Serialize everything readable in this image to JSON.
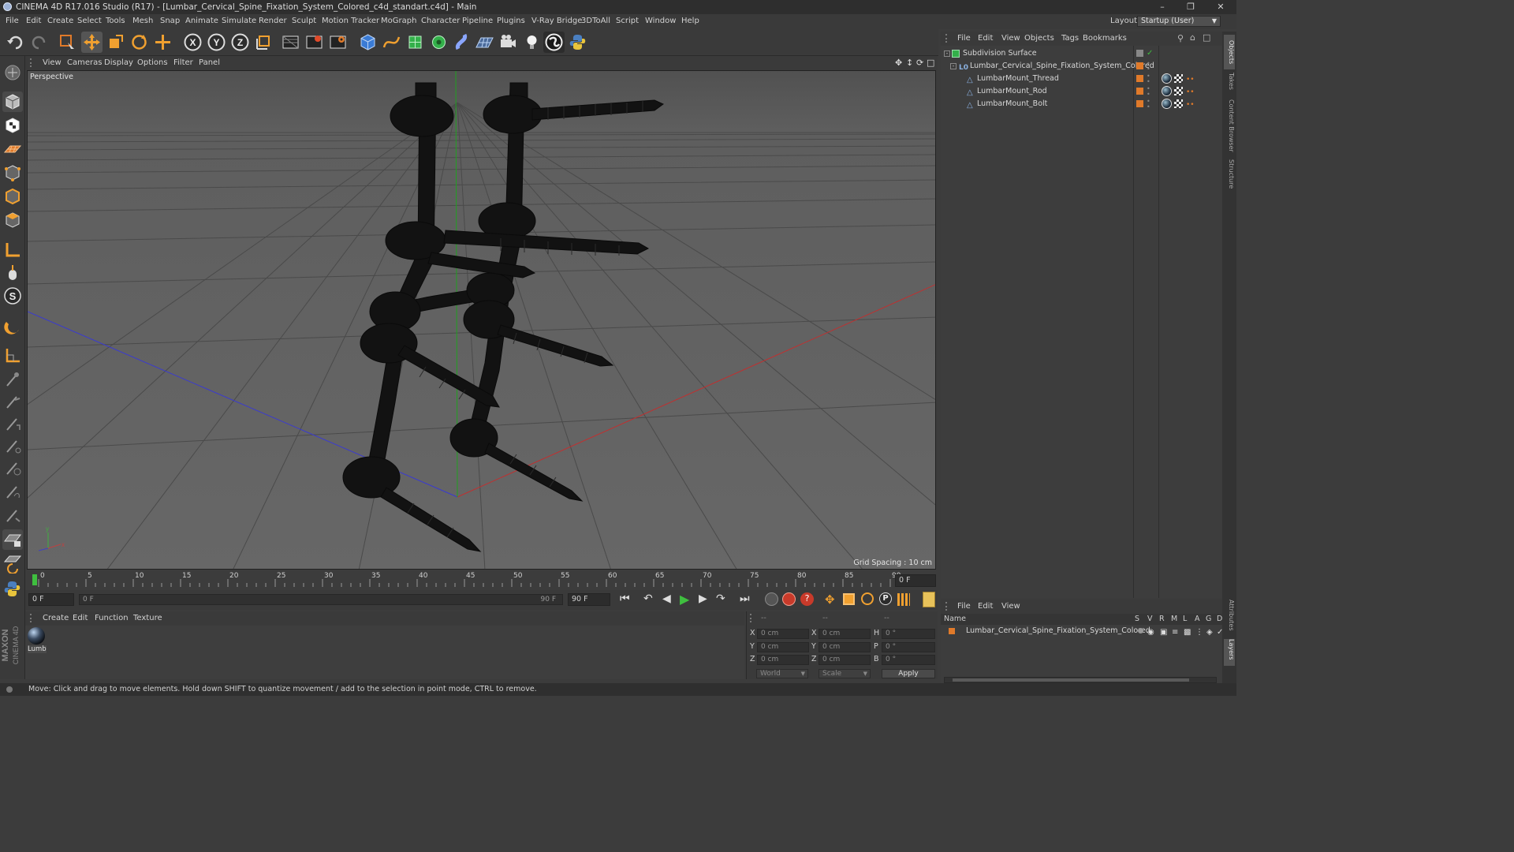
{
  "window": {
    "title": "CINEMA 4D R17.016 Studio (R17) - [Lumbar_Cervical_Spine_Fixation_System_Colored_c4d_standart.c4d] - Main"
  },
  "menubar": {
    "items": [
      "File",
      "Edit",
      "Create",
      "Select",
      "Tools",
      "Mesh",
      "Snap",
      "Animate",
      "Simulate",
      "Render",
      "Sculpt",
      "Motion Tracker",
      "MoGraph",
      "Character",
      "Pipeline",
      "Plugins",
      "V-Ray Bridge",
      "3DToAll",
      "Script",
      "Window",
      "Help"
    ],
    "layout_label": "Layout:",
    "layout_value": "Startup (User)"
  },
  "viewport": {
    "menu": [
      "View",
      "Cameras",
      "Display",
      "Options",
      "Filter",
      "Panel"
    ],
    "label": "Perspective",
    "grid_spacing": "Grid Spacing : 10 cm"
  },
  "timeline": {
    "ticks": [
      "0",
      "5",
      "10",
      "15",
      "20",
      "25",
      "30",
      "35",
      "40",
      "45",
      "50",
      "55",
      "60",
      "65",
      "70",
      "75",
      "80",
      "85",
      "90"
    ],
    "end_field": "0 F",
    "start_field": "0 F",
    "slider_start": "0 F",
    "slider_end": "90 F",
    "max_field": "90 F"
  },
  "material_manager": {
    "menu": [
      "Create",
      "Edit",
      "Function",
      "Texture"
    ],
    "material_name": "Lumb"
  },
  "coordinates": {
    "headers": [
      "--",
      "--",
      "--"
    ],
    "rows": [
      {
        "axis": "X",
        "pos": "0 cm",
        "axis2": "X",
        "size": "0 cm",
        "rot_axis": "H",
        "rot": "0 °"
      },
      {
        "axis": "Y",
        "pos": "0 cm",
        "axis2": "Y",
        "size": "0 cm",
        "rot_axis": "P",
        "rot": "0 °"
      },
      {
        "axis": "Z",
        "pos": "0 cm",
        "axis2": "Z",
        "size": "0 cm",
        "rot_axis": "B",
        "rot": "0 °"
      }
    ],
    "world": "World",
    "scale": "Scale",
    "apply": "Apply"
  },
  "object_manager": {
    "menu": [
      "File",
      "Edit",
      "View",
      "Objects",
      "Tags",
      "Bookmarks"
    ],
    "objects": [
      {
        "name": "Subdivision Surface",
        "indent": 0
      },
      {
        "name": "Lumbar_Cervical_Spine_Fixation_System_Colored",
        "indent": 1
      },
      {
        "name": "LumbarMount_Thread",
        "indent": 2
      },
      {
        "name": "LumbarMount_Rod",
        "indent": 2
      },
      {
        "name": "LumbarMount_Bolt",
        "indent": 2
      }
    ]
  },
  "attributes": {
    "menu": [
      "File",
      "Edit",
      "View"
    ],
    "columns": [
      "Name",
      "S",
      "V",
      "R",
      "M",
      "L",
      "A",
      "G",
      "D"
    ],
    "row": "Lumbar_Cervical_Spine_Fixation_System_Colored"
  },
  "side_tabs": [
    "Objects",
    "Takes",
    "Content Browser",
    "Structure",
    "Attributes",
    "Layers"
  ],
  "status": "Move: Click and drag to move elements. Hold down SHIFT to quantize movement / add to the selection in point mode, CTRL to remove.",
  "colors": {
    "accent_orange": "#e07a2a",
    "accent_green": "#3fbf3f",
    "tool_blue": "#3a7bd5",
    "axis_red": "#c03030",
    "axis_blue": "#3a3ad0",
    "axis_green": "#20a020"
  },
  "branding": "MAXON CINEMA 4D"
}
